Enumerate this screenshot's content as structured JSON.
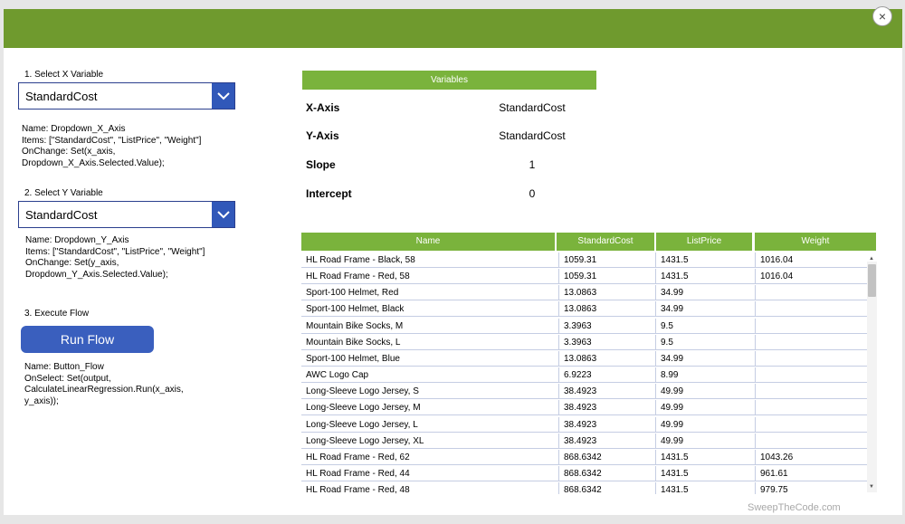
{
  "close_label": "×",
  "x_var": {
    "label": "1. Select X Variable",
    "selected": "StandardCost",
    "code": [
      "Name: Dropdown_X_Axis",
      "Items: [\"StandardCost\", \"ListPrice\", \"Weight\"]",
      "OnChange: Set(x_axis,",
      "Dropdown_X_Axis.Selected.Value);"
    ]
  },
  "y_var": {
    "label": "2. Select Y Variable",
    "selected": "StandardCost",
    "code": [
      "Name: Dropdown_Y_Axis",
      "Items: [\"StandardCost\", \"ListPrice\", \"Weight\"]",
      "OnChange: Set(y_axis,",
      "Dropdown_Y_Axis.Selected.Value);"
    ]
  },
  "execute": {
    "label": "3. Execute Flow",
    "button": "Run Flow",
    "code": [
      "Name: Button_Flow",
      "OnSelect: Set(output,",
      "CalculateLinearRegression.Run(x_axis,",
      "y_axis));"
    ]
  },
  "variables": {
    "header": "Variables",
    "rows": [
      {
        "key": "X-Axis",
        "value": "StandardCost"
      },
      {
        "key": "Y-Axis",
        "value": "StandardCost"
      },
      {
        "key": "Slope",
        "value": "1"
      },
      {
        "key": "Intercept",
        "value": "0"
      }
    ]
  },
  "table": {
    "columns": [
      "Name",
      "StandardCost",
      "ListPrice",
      "Weight"
    ],
    "rows": [
      [
        "HL Road Frame - Black, 58",
        "1059.31",
        "1431.5",
        "1016.04"
      ],
      [
        "HL Road Frame - Red, 58",
        "1059.31",
        "1431.5",
        "1016.04"
      ],
      [
        "Sport-100 Helmet, Red",
        "13.0863",
        "34.99",
        ""
      ],
      [
        "Sport-100 Helmet, Black",
        "13.0863",
        "34.99",
        ""
      ],
      [
        "Mountain Bike Socks, M",
        "3.3963",
        "9.5",
        ""
      ],
      [
        "Mountain Bike Socks, L",
        "3.3963",
        "9.5",
        ""
      ],
      [
        "Sport-100 Helmet, Blue",
        "13.0863",
        "34.99",
        ""
      ],
      [
        "AWC Logo Cap",
        "6.9223",
        "8.99",
        ""
      ],
      [
        "Long-Sleeve Logo Jersey, S",
        "38.4923",
        "49.99",
        ""
      ],
      [
        "Long-Sleeve Logo Jersey, M",
        "38.4923",
        "49.99",
        ""
      ],
      [
        "Long-Sleeve Logo Jersey, L",
        "38.4923",
        "49.99",
        ""
      ],
      [
        "Long-Sleeve Logo Jersey, XL",
        "38.4923",
        "49.99",
        ""
      ],
      [
        "HL Road Frame - Red, 62",
        "868.6342",
        "1431.5",
        "1043.26"
      ],
      [
        "HL Road Frame - Red, 44",
        "868.6342",
        "1431.5",
        "961.61"
      ],
      [
        "HL Road Frame - Red, 48",
        "868.6342",
        "1431.5",
        "979.75"
      ]
    ]
  },
  "watermark": "SweepTheCode.com",
  "colors": {
    "header_bar": "#6f9a2e",
    "accent_green": "#7ab33c",
    "button_blue": "#3a5fbe",
    "dropdown_blue": "#3158b9"
  }
}
